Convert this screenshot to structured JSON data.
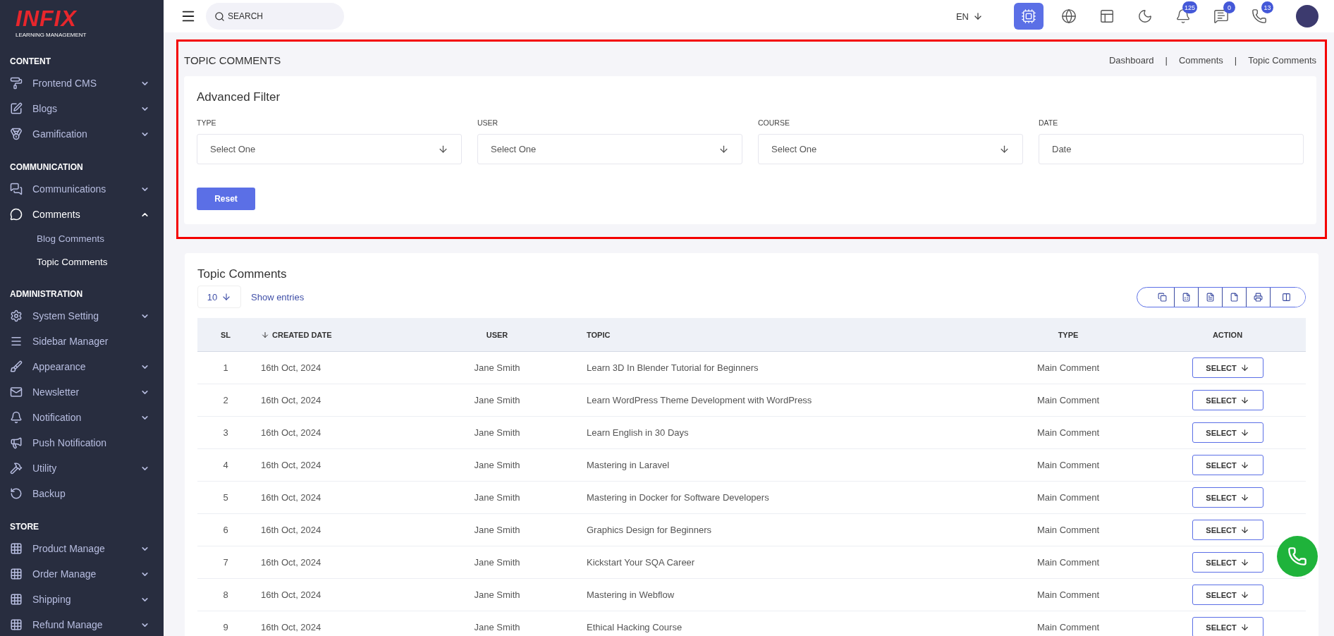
{
  "sidebar": {
    "logo": {
      "brand": "INFIX",
      "tagline": "LEARNING MANAGEMENT"
    },
    "sections": [
      {
        "title": "CONTENT",
        "items": [
          {
            "label": "Frontend CMS",
            "kind": "group",
            "expanded": false
          },
          {
            "label": "Blogs",
            "kind": "group",
            "expanded": false
          },
          {
            "label": "Gamification",
            "kind": "group",
            "expanded": false
          }
        ]
      },
      {
        "title": "COMMUNICATION",
        "items": [
          {
            "label": "Communications",
            "kind": "group",
            "expanded": false
          },
          {
            "label": "Comments",
            "kind": "group",
            "expanded": true,
            "children": [
              {
                "label": "Blog Comments",
                "selected": false
              },
              {
                "label": "Topic Comments",
                "selected": true
              }
            ]
          }
        ]
      },
      {
        "title": "ADMINISTRATION",
        "items": [
          {
            "label": "System Setting",
            "kind": "group",
            "expanded": false
          },
          {
            "label": "Sidebar Manager",
            "kind": "link"
          },
          {
            "label": "Appearance",
            "kind": "group",
            "expanded": false
          },
          {
            "label": "Newsletter",
            "kind": "group",
            "expanded": false
          },
          {
            "label": "Notification",
            "kind": "group",
            "expanded": false
          },
          {
            "label": "Push Notification",
            "kind": "link"
          },
          {
            "label": "Utility",
            "kind": "group",
            "expanded": false
          },
          {
            "label": "Backup",
            "kind": "link"
          }
        ]
      },
      {
        "title": "STORE",
        "items": [
          {
            "label": "Product Manage",
            "kind": "group",
            "expanded": false
          },
          {
            "label": "Order Manage",
            "kind": "group",
            "expanded": false
          },
          {
            "label": "Shipping",
            "kind": "group",
            "expanded": false
          },
          {
            "label": "Refund Manage",
            "kind": "group",
            "expanded": false
          }
        ]
      }
    ]
  },
  "topbar": {
    "search": {
      "placeholder": "SEARCH"
    },
    "language": "EN",
    "icons": [
      {
        "active": true
      },
      {
        "active": false
      },
      {
        "active": false
      },
      {
        "active": false
      },
      {
        "active": false,
        "badge": "125"
      },
      {
        "active": false,
        "badge": "0"
      },
      {
        "active": false,
        "badge": "13"
      }
    ]
  },
  "page_header": {
    "title": "TOPIC COMMENTS",
    "breadcrumb": [
      {
        "label": "Dashboard"
      },
      {
        "label": "Comments"
      },
      {
        "label": "Topic Comments"
      }
    ],
    "separators": [
      "|",
      "|"
    ]
  },
  "filter": {
    "title": "Advanced Filter",
    "fields": [
      {
        "label": "TYPE",
        "kind": "select",
        "value": "Select One"
      },
      {
        "label": "USER",
        "kind": "select",
        "value": "Select One"
      },
      {
        "label": "COURSE",
        "kind": "select",
        "value": "Select One"
      },
      {
        "label": "DATE",
        "kind": "date",
        "placeholder": "Date"
      }
    ],
    "reset_button": "Reset"
  },
  "table": {
    "title": "Topic Comments",
    "page_size": "10",
    "show_entries": "Show entries",
    "columns": [
      {
        "label": "SL",
        "sorted": false
      },
      {
        "label": "CREATED DATE",
        "sorted": true
      },
      {
        "label": "USER",
        "sorted": false
      },
      {
        "label": "TOPIC",
        "sorted": false
      },
      {
        "label": "TYPE",
        "sorted": false
      },
      {
        "label": "ACTION",
        "sorted": false
      }
    ],
    "rows": [
      {
        "sl": "1",
        "date": "16th Oct, 2024",
        "user": "Jane Smith",
        "topic": "Learn 3D In Blender Tutorial for Beginners",
        "type": "Main Comment",
        "action": "SELECT"
      },
      {
        "sl": "2",
        "date": "16th Oct, 2024",
        "user": "Jane Smith",
        "topic": "Learn WordPress Theme Development with WordPress",
        "type": "Main Comment",
        "action": "SELECT"
      },
      {
        "sl": "3",
        "date": "16th Oct, 2024",
        "user": "Jane Smith",
        "topic": "Learn English in 30 Days",
        "type": "Main Comment",
        "action": "SELECT"
      },
      {
        "sl": "4",
        "date": "16th Oct, 2024",
        "user": "Jane Smith",
        "topic": "Mastering in Laravel",
        "type": "Main Comment",
        "action": "SELECT"
      },
      {
        "sl": "5",
        "date": "16th Oct, 2024",
        "user": "Jane Smith",
        "topic": "Mastering in Docker for Software Developers",
        "type": "Main Comment",
        "action": "SELECT"
      },
      {
        "sl": "6",
        "date": "16th Oct, 2024",
        "user": "Jane Smith",
        "topic": "Graphics Design for Beginners",
        "type": "Main Comment",
        "action": "SELECT"
      },
      {
        "sl": "7",
        "date": "16th Oct, 2024",
        "user": "Jane Smith",
        "topic": "Kickstart Your SQA Career",
        "type": "Main Comment",
        "action": "SELECT"
      },
      {
        "sl": "8",
        "date": "16th Oct, 2024",
        "user": "Jane Smith",
        "topic": "Mastering in Webflow",
        "type": "Main Comment",
        "action": "SELECT"
      },
      {
        "sl": "9",
        "date": "16th Oct, 2024",
        "user": "Jane Smith",
        "topic": "Ethical Hacking Course",
        "type": "Main Comment",
        "action": "SELECT"
      }
    ]
  }
}
